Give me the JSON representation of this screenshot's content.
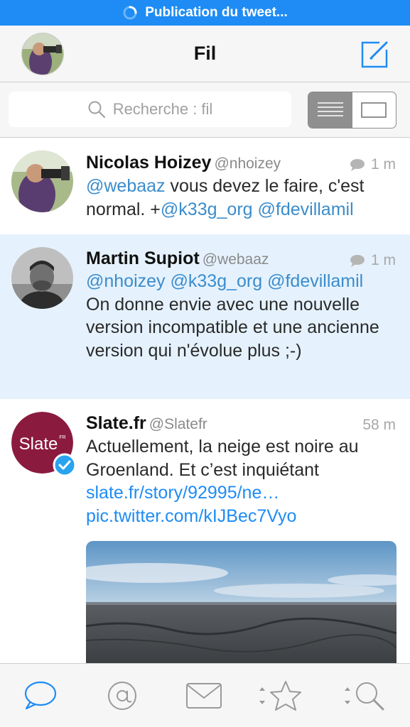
{
  "status_bar": {
    "text": "Publication du tweet..."
  },
  "nav": {
    "title": "Fil"
  },
  "search": {
    "placeholder": "Recherche : fil"
  },
  "tweets": [
    {
      "name": "Nicolas Hoizey",
      "handle": "@nhoizey",
      "time": "1 m",
      "has_conversation_icon": true,
      "body": {
        "m1": "@webaaz",
        "t1": " vous devez le faire, c'est normal. +",
        "m2": "@k33g_org",
        "t2": " ",
        "m3": "@fdevillamil"
      }
    },
    {
      "name": "Martin Supiot",
      "handle": "@webaaz",
      "time": "1 m",
      "has_conversation_icon": true,
      "highlighted": true,
      "body": {
        "m1": "@nhoizey",
        "m2": "@k33g_org",
        "m3": "@fdevillamil",
        "text": "On donne envie avec une nouvelle version incompatible et une ancienne version qui n'évolue plus ;-)"
      }
    },
    {
      "name": "Slate.fr",
      "handle": "@Slatefr",
      "time": "58 m",
      "verified": true,
      "avatar_text": "Slate",
      "avatar_sup": "FR",
      "body": {
        "text": "Actuellement, la neige est noire au Groenland. Et c’est inquiétant",
        "link1": "slate.fr/story/92995/ne…",
        "link2": "pic.twitter.com/kIJBec7Vyo"
      }
    }
  ],
  "tabs": [
    "conversation-icon",
    "at-icon",
    "mail-icon",
    "star-icon",
    "search-icon"
  ],
  "colors": {
    "accent": "#1E8CF4",
    "mention": "#3B8CCB",
    "highlight_bg": "#E5F2FE",
    "slate_brand": "#8B1A3F",
    "verified": "#2AA3EF"
  }
}
